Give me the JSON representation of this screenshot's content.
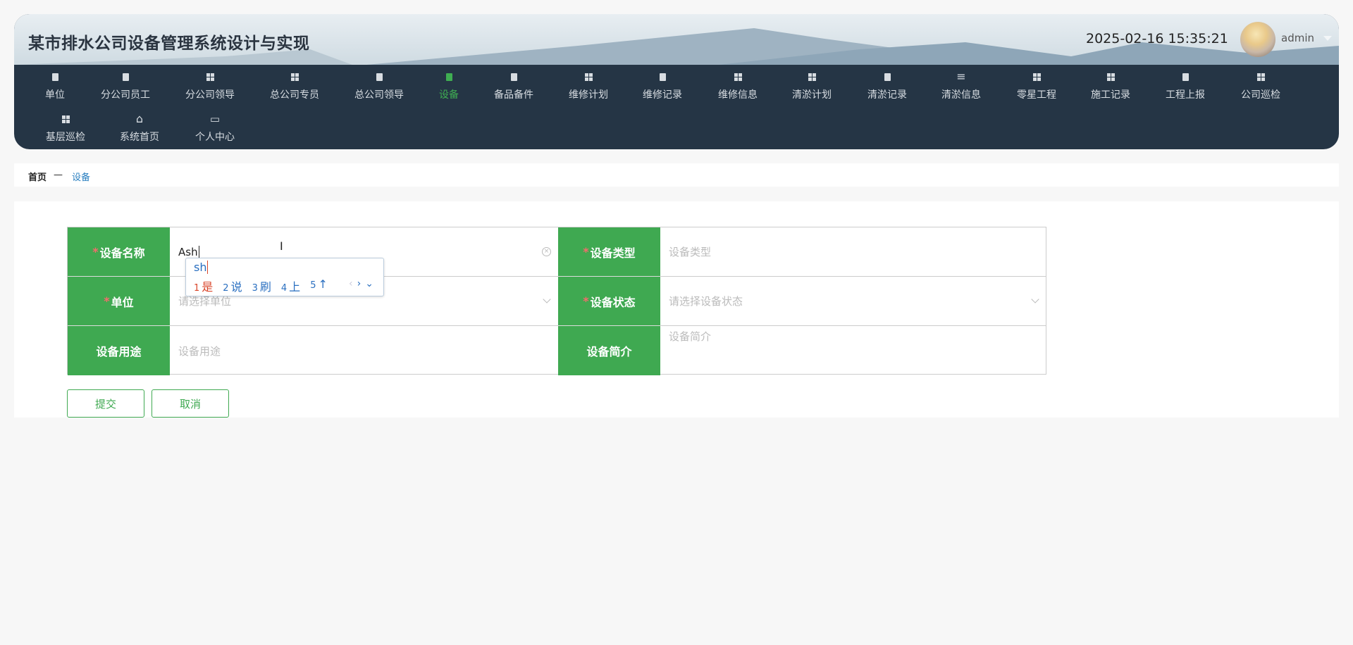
{
  "header": {
    "title": "某市排水公司设备管理系统设计与实现",
    "datetime": "2025-02-16 15:35:21",
    "user": "admin"
  },
  "nav": [
    {
      "label": "单位",
      "icon": "clipboard-check-icon"
    },
    {
      "label": "分公司员工",
      "icon": "books-icon"
    },
    {
      "label": "分公司领导",
      "icon": "grid-icon"
    },
    {
      "label": "总公司专员",
      "icon": "grid-icon"
    },
    {
      "label": "总公司领导",
      "icon": "wallet-icon"
    },
    {
      "label": "设备",
      "icon": "clipboard-icon",
      "active": true
    },
    {
      "label": "备品备件",
      "icon": "ticket-icon"
    },
    {
      "label": "维修计划",
      "icon": "grid-icon"
    },
    {
      "label": "维修记录",
      "icon": "cup-icon"
    },
    {
      "label": "维修信息",
      "icon": "grid-icon"
    },
    {
      "label": "清淤计划",
      "icon": "grid-icon"
    },
    {
      "label": "清淤记录",
      "icon": "clipboard-x-icon"
    },
    {
      "label": "清淤信息",
      "icon": "list-icon"
    },
    {
      "label": "零星工程",
      "icon": "grid-icon"
    },
    {
      "label": "施工记录",
      "icon": "grid-icon"
    },
    {
      "label": "工程上报",
      "icon": "briefcase-icon"
    },
    {
      "label": "公司巡检",
      "icon": "grid-icon"
    },
    {
      "label": "基层巡检",
      "icon": "grid-icon"
    },
    {
      "label": "系统首页",
      "icon": "home-icon"
    },
    {
      "label": "个人中心",
      "icon": "card-icon"
    }
  ],
  "breadcrumb": {
    "home": "首页",
    "sep": "—",
    "current": "设备"
  },
  "form": {
    "name": {
      "label": "设备名称",
      "value": "Ash"
    },
    "type": {
      "label": "设备类型",
      "placeholder": "设备类型"
    },
    "unit": {
      "label": "单位",
      "placeholder": "请选择单位"
    },
    "status": {
      "label": "设备状态",
      "placeholder": "请选择设备状态"
    },
    "usage": {
      "label": "设备用途",
      "placeholder": "设备用途"
    },
    "intro": {
      "label": "设备简介",
      "placeholder": "设备简介"
    },
    "required_mark": "*",
    "submit": "提交",
    "cancel": "取消"
  },
  "ime": {
    "composition": "sh",
    "candidates": [
      {
        "n": "1",
        "t": "是"
      },
      {
        "n": "2",
        "t": "说"
      },
      {
        "n": "3",
        "t": "刷"
      },
      {
        "n": "4",
        "t": "上"
      },
      {
        "n": "5",
        "t": "↑"
      }
    ]
  },
  "colors": {
    "accent": "#3fa951",
    "nav_bg": "#253545",
    "active_nav": "#3fae52",
    "required": "#f56c6c"
  }
}
